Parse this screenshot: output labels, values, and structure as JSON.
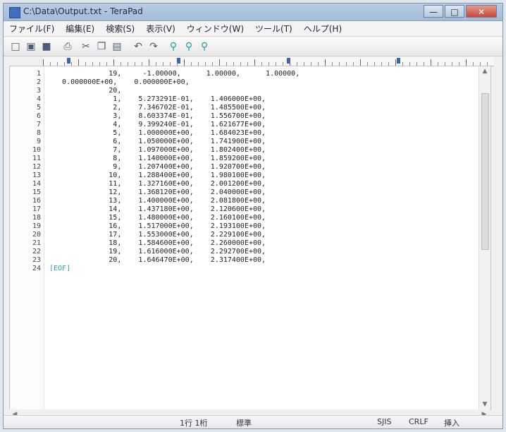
{
  "titlebar": {
    "title": "C:\\Data\\Output.txt - TeraPad",
    "minimize_label": "—",
    "maximize_label": "□",
    "close_label": "✕"
  },
  "menu": {
    "items": [
      "ファイル(F)",
      "編集(E)",
      "検索(S)",
      "表示(V)",
      "ウィンドウ(W)",
      "ツール(T)",
      "ヘルプ(H)"
    ]
  },
  "toolbar": {
    "icons": [
      "new-file-icon",
      "open-file-icon",
      "save-file-icon",
      "print-icon",
      "cut-icon",
      "copy-icon",
      "paste-icon",
      "undo-icon",
      "redo-icon",
      "search-icon",
      "search-next-icon",
      "search-previous-icon"
    ]
  },
  "editor": {
    "line_numbers": [
      "1",
      "2",
      "3",
      "4",
      "5",
      "6",
      "7",
      "8",
      "9",
      "10",
      "11",
      "12",
      "13",
      "14",
      "15",
      "16",
      "17",
      "18",
      "19",
      "20",
      "21",
      "22",
      "23",
      "24"
    ],
    "lines": [
      "              19,     -1.00000,      1.00000,      1.00000,",
      "   0.000000E+00,    0.000000E+00,",
      "              20,",
      "               1,    5.273291E-01,    1.406000E+00,",
      "               2,    7.346702E-01,    1.485500E+00,",
      "               3,    8.603374E-01,    1.556700E+00,",
      "               4,    9.399240E-01,    1.621677E+00,",
      "               5,    1.000000E+00,    1.684023E+00,",
      "               6,    1.050000E+00,    1.741900E+00,",
      "               7,    1.097000E+00,    1.802400E+00,",
      "               8,    1.140000E+00,    1.859200E+00,",
      "               9,    1.207400E+00,    1.920700E+00,",
      "              10,    1.288400E+00,    1.980100E+00,",
      "              11,    1.327160E+00,    2.001200E+00,",
      "              12,    1.368120E+00,    2.040000E+00,",
      "              13,    1.400000E+00,    2.081800E+00,",
      "              14,    1.437180E+00,    2.120600E+00,",
      "              15,    1.480000E+00,    2.160100E+00,",
      "              16,    1.517000E+00,    2.193100E+00,",
      "              17,    1.553000E+00,    2.229100E+00,",
      "              18,    1.584600E+00,    2.260000E+00,",
      "              19,    1.616000E+00,    2.292700E+00,",
      "              20,    1.646470E+00,    2.317400E+00,",
      "[EOF]"
    ]
  },
  "statusbar": {
    "position": "1行  1桁",
    "mode": "標準",
    "encoding": "SJIS",
    "line_ending": "CRLF",
    "insert_mode": "挿入"
  }
}
